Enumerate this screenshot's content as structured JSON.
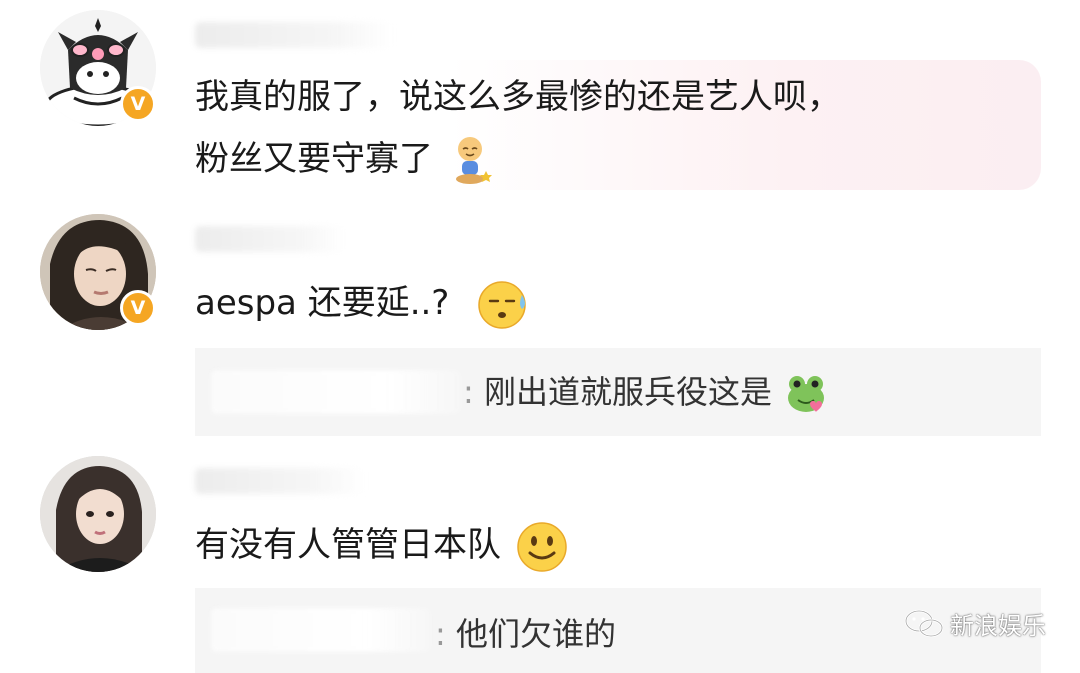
{
  "comments": [
    {
      "text_line1": "我真的服了，说这么多最惨的还是艺人呗，",
      "text_line2": "粉丝又要守寡了",
      "emoji": "meditating-person-emoji",
      "verified_mark": "V"
    },
    {
      "text": "aespa 还要延..?",
      "emoji": "sweat-face-emoji",
      "verified_mark": "V",
      "reply": {
        "separator": ":",
        "text": "刚出道就服兵役这是",
        "emoji": "frog-heart-emoji"
      }
    },
    {
      "text": "有没有人管管日本队",
      "emoji": "smiley-face-emoji",
      "reply": {
        "separator": ":",
        "text": "他们欠谁的"
      }
    }
  ],
  "watermark": {
    "icon": "wechat-icon",
    "text": "新浪娱乐"
  },
  "colors": {
    "verified_badge": "#f5a623",
    "reply_bg": "#f5f5f5",
    "bubble_tint": "#fbeef2"
  }
}
